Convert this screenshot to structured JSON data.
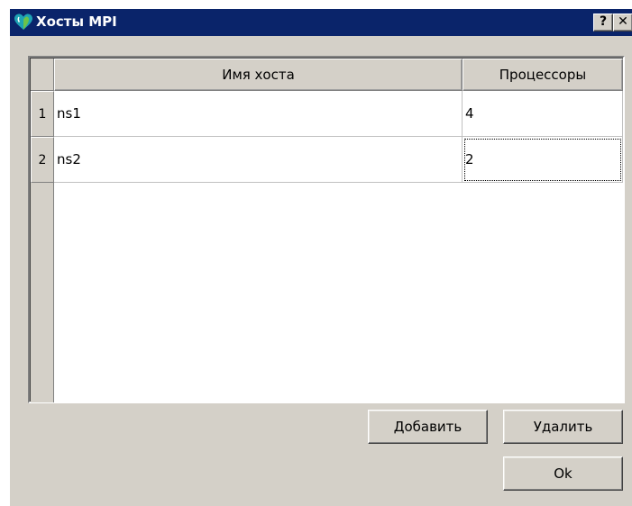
{
  "window": {
    "title": "Хосты MPI",
    "help_label": "?",
    "close_label": "✕",
    "app_icon": "app-heart-icon"
  },
  "table": {
    "columns": [
      "Имя хоста",
      "Процессоры"
    ],
    "rows": [
      {
        "index": "1",
        "host": "ns1",
        "processors": "4"
      },
      {
        "index": "2",
        "host": "ns2",
        "processors": "2"
      }
    ]
  },
  "buttons": {
    "add": "Добавить",
    "delete": "Удалить",
    "ok": "Ok"
  },
  "colors": {
    "titlebar": "#0a246a",
    "dialog_bg": "#d4d0c8",
    "icon_teal": "#1ea3b4",
    "icon_green": "#6cc24a"
  }
}
